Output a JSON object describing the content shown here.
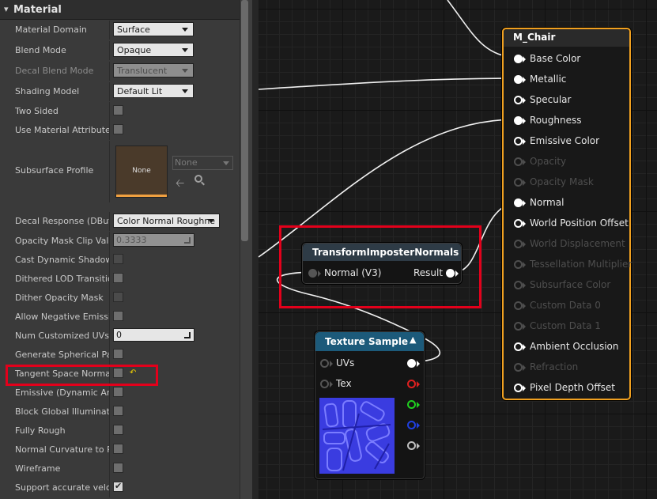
{
  "panel": {
    "title": "Material",
    "rows": [
      {
        "label": "Material Domain",
        "value": "Surface"
      },
      {
        "label": "Blend Mode",
        "value": "Opaque"
      },
      {
        "label": "Decal Blend Mode",
        "value": "Translucent"
      },
      {
        "label": "Shading Model",
        "value": "Default Lit"
      },
      {
        "label": "Two Sided"
      },
      {
        "label": "Use Material Attributes"
      },
      {
        "label": "Subsurface Profile",
        "thumb": "None",
        "asset": "None"
      },
      {
        "label": "Decal Response (DBuffe",
        "value": "Color Normal Roughne"
      },
      {
        "label": "Opacity Mask Clip Valu",
        "value": "0.3333"
      },
      {
        "label": "Cast Dynamic Shadow a"
      },
      {
        "label": "Dithered LOD Transition"
      },
      {
        "label": "Dither Opacity Mask"
      },
      {
        "label": "Allow Negative Emissiv"
      },
      {
        "label": "Num Customized UVs",
        "value": "0"
      },
      {
        "label": "Generate Spherical Part"
      },
      {
        "label": "Tangent Space Normal"
      },
      {
        "label": "Emissive (Dynamic Area"
      },
      {
        "label": "Block Global Illuminatio"
      },
      {
        "label": "Fully Rough"
      },
      {
        "label": "Normal Curvature to Ro"
      },
      {
        "label": "Wireframe"
      },
      {
        "label": "Support accurate veloci"
      }
    ]
  },
  "graph": {
    "material_node": {
      "title": "M_Chair",
      "inputs": [
        {
          "label": "Base Color",
          "state": "connected"
        },
        {
          "label": "Metallic",
          "state": "connected"
        },
        {
          "label": "Specular",
          "state": "open"
        },
        {
          "label": "Roughness",
          "state": "connected"
        },
        {
          "label": "Emissive Color",
          "state": "open"
        },
        {
          "label": "Opacity",
          "state": "disabled"
        },
        {
          "label": "Opacity Mask",
          "state": "disabled"
        },
        {
          "label": "Normal",
          "state": "connected"
        },
        {
          "label": "World Position Offset",
          "state": "open"
        },
        {
          "label": "World Displacement",
          "state": "disabled"
        },
        {
          "label": "Tessellation Multiplier",
          "state": "disabled"
        },
        {
          "label": "Subsurface Color",
          "state": "disabled"
        },
        {
          "label": "Custom Data 0",
          "state": "disabled"
        },
        {
          "label": "Custom Data 1",
          "state": "disabled"
        },
        {
          "label": "Ambient Occlusion",
          "state": "open"
        },
        {
          "label": "Refraction",
          "state": "disabled"
        },
        {
          "label": "Pixel Depth Offset",
          "state": "open"
        }
      ]
    },
    "transform_node": {
      "title": "TransformImposterNormals",
      "input": "Normal (V3)",
      "output": "Result"
    },
    "texture_node": {
      "title": "Texture Sample",
      "inputs": [
        "UVs",
        "Tex"
      ]
    }
  },
  "colors": {
    "highlight": "#e3001b",
    "selected_node_border": "#f0a020",
    "transform_header": "#2e3b46",
    "texture_header": "#1c5a7a"
  }
}
